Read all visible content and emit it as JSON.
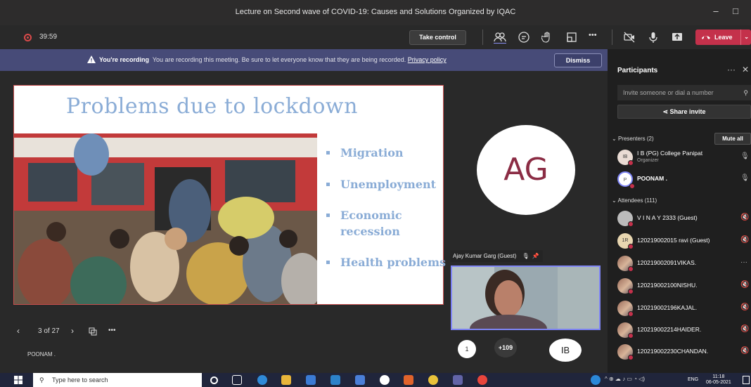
{
  "window": {
    "title": "Lecture on Second wave of COVID-19: Causes and Solutions Organized by IQAC",
    "minimize": "–",
    "maximize": "□"
  },
  "toolbar": {
    "timer": "39:59",
    "take_control": "Take control",
    "more": "•••",
    "leave": "Leave"
  },
  "banner": {
    "strong": "You're recording",
    "message": "You are recording this meeting. Be sure to let everyone know that they are being recorded.",
    "link": "Privacy policy",
    "dismiss": "Dismiss"
  },
  "slide": {
    "title": "Problems due to lockdown",
    "bullets": [
      "Migration",
      "Unemployment",
      "Economic",
      "recession",
      "Health problems"
    ],
    "page": "3 of 27",
    "presenter": "POONAM ."
  },
  "stage": {
    "ag_initials": "AG",
    "video_label": "Ajay Kumar Garg (Guest)",
    "mini_count": "1",
    "more_count": "+109",
    "ib_initials": "IB"
  },
  "participants": {
    "title": "Participants",
    "more": "···",
    "close": "✕",
    "invite_placeholder": "Invite someone or dial a number",
    "share": "Share invite",
    "presenters_header": "Presenters (2)",
    "mute_all": "Mute all",
    "attendees_header": "Attendees (111)",
    "presenters": [
      {
        "initials": "IB",
        "name": "I B (PG) College Panipat",
        "role": "Organizer"
      },
      {
        "initials": "P",
        "name": "POONAM .",
        "role": ""
      }
    ],
    "attendees": [
      {
        "initials": "",
        "name": "V I N A Y 2333 (Guest)"
      },
      {
        "initials": "1R",
        "name": "120219002015 ravi (Guest)"
      },
      {
        "initials": "",
        "name": "120219002091VIKAS."
      },
      {
        "initials": "",
        "name": "120219002100NISHU."
      },
      {
        "initials": "",
        "name": "120219002196KAJAL."
      },
      {
        "initials": "",
        "name": "120219002214HAIDER."
      },
      {
        "initials": "",
        "name": "120219002230CHANDAN."
      }
    ]
  },
  "taskbar": {
    "search": "Type here to search",
    "lang": "ENG",
    "time": "11:18",
    "date": "06-05-2021"
  }
}
